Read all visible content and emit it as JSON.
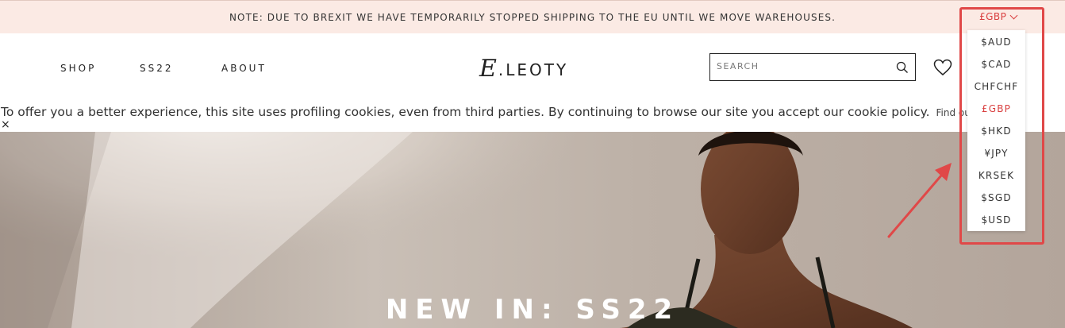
{
  "banner": {
    "notice": "NOTE: DUE TO BREXIT WE HAVE TEMPORARILY STOPPED SHIPPING TO THE EU UNTIL WE MOVE WAREHOUSES.",
    "currency_selected": "£GBP"
  },
  "nav": {
    "items": [
      {
        "label": "SHOP"
      },
      {
        "label": "SS22"
      },
      {
        "label": "ABOUT"
      }
    ]
  },
  "logo": {
    "mark": "E",
    "text": ".LEOTY"
  },
  "search": {
    "placeholder": "SEARCH"
  },
  "cookie": {
    "message": "To offer you a better experience, this site uses profiling cookies, even from third parties. By continuing to browse our site you accept our cookie policy.",
    "link": "Find our",
    "close": "×"
  },
  "currency_dropdown": {
    "options": [
      {
        "label": "$AUD",
        "selected": false
      },
      {
        "label": "$CAD",
        "selected": false
      },
      {
        "label": "CHFCHF",
        "selected": false
      },
      {
        "label": "£GBP",
        "selected": true
      },
      {
        "label": "$HKD",
        "selected": false
      },
      {
        "label": "¥JPY",
        "selected": false
      },
      {
        "label": "KRSEK",
        "selected": false
      },
      {
        "label": "$SGD",
        "selected": false
      },
      {
        "label": "$USD",
        "selected": false
      }
    ]
  },
  "hero": {
    "headline": "NEW IN: SS22"
  },
  "colors": {
    "banner_bg": "#fbeae4",
    "accent_red": "#d94040",
    "annotation_red": "#e04848",
    "text": "#222222"
  },
  "icons": {
    "search": "search-icon",
    "wishlist": "heart-icon",
    "currency_caret": "chevron-down-icon",
    "close": "close-icon"
  }
}
